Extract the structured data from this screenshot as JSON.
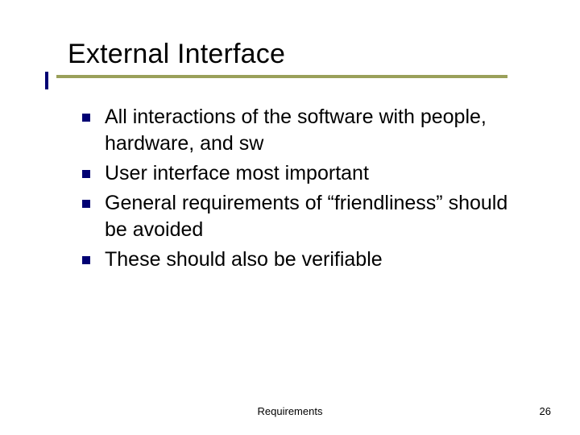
{
  "title": "External Interface",
  "bullets": [
    "All interactions of the software with people, hardware, and sw",
    "User interface most important",
    "General requirements of “friendliness” should be avoided",
    "These should also be verifiable"
  ],
  "footer": {
    "center": "Requirements",
    "page": "26"
  }
}
